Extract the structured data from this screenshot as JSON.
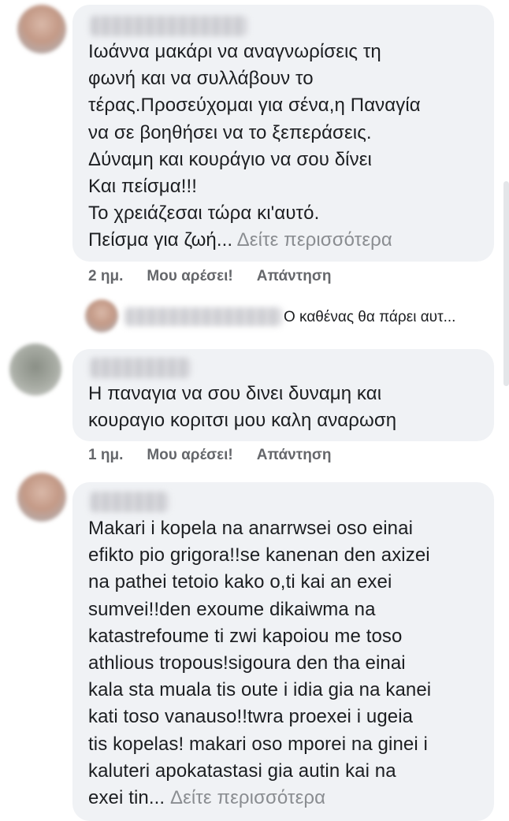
{
  "comments": [
    {
      "text": "Ιωάννα μακάρι να αναγνωρίσεις τη\nφωνή και να συλλάβουν το\nτέρας.Προσεύχομαι για σένα,η Παναγία\nνα σε βοηθήσει να το ξεπεράσεις.\nΔύναμη και κουράγιο να σου δίνει\nΚαι πείσμα!!!\nΤο χρειάζεσαι τώρα κι'αυτό.\nΠείσμα για ζωή...",
      "see_more": "Δείτε περισσότερα",
      "time": "2 ημ.",
      "like": "Μου αρέσει!",
      "reply": "Απάντηση"
    },
    {
      "text": "Η παναγια να σου δινει δυναμη και\nκουραγιο κοριτσι μου  καλη αναρωση",
      "time": "1 ημ.",
      "like": "Μου αρέσει!",
      "reply": "Απάντηση"
    },
    {
      "text": "Makari i kopela na anarrwsei oso einai\nefikto pio grigora!!se kanenan den axizei\nna pathei tetoio kako o,ti kai an exei\nsumvei!!den exoume dikaiwma na\nkatastrefoume ti zwi kapoiou me toso\nathlious tropous!sigoura den tha einai\nkala sta muala tis oute i idia gia na kanei\nkati toso vanauso!!twra proexei i ugeia\ntis kopelas! makari oso mporei na ginei i\nkaluteri apokatastasi gia autin kai na\nexei tin...",
      "see_more": "Δείτε περισσότερα"
    }
  ],
  "reply_preview": {
    "text": "Ο καθένας θα πάρει αυτ..."
  }
}
